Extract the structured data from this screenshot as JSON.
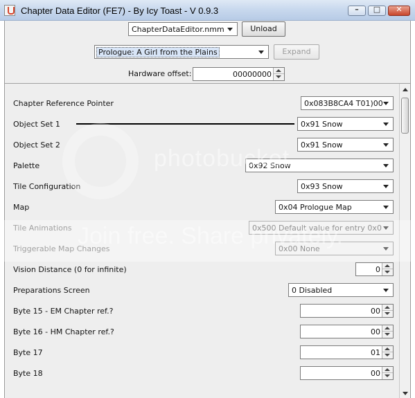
{
  "window": {
    "title": "Chapter Data Editor (FE7) - By Icy Toast - V 0.9.3"
  },
  "top": {
    "module_select": "ChapterDataEditor.nmm",
    "unload_label": "Unload",
    "chapter_select": "Prologue: A Girl from the Plains",
    "expand_label": "Expand",
    "hardware_offset_label": "Hardware offset:",
    "hardware_offset_value": "00000000"
  },
  "fields": [
    {
      "label": "Chapter Reference Pointer",
      "value": "0x083B8CA4 T01)00"
    },
    {
      "label": "Object Set 1",
      "value": "0x91 Snow"
    },
    {
      "label": "Object Set 2",
      "value": "0x91 Snow"
    },
    {
      "label": "Palette",
      "value": "0x92 Snow"
    },
    {
      "label": "Tile Configuration",
      "value": "0x93 Snow"
    },
    {
      "label": "Map",
      "value": "0x04 Prologue Map"
    },
    {
      "label": "Tile Animations",
      "value": "0x500 Default value for entry 0x0"
    },
    {
      "label": "Triggerable Map Changes",
      "value": "0x00 None"
    },
    {
      "label": "Vision Distance (0 for infinite)",
      "value": "0"
    },
    {
      "label": "Preparations Screen",
      "value": "0 Disabled"
    },
    {
      "label": "Byte 15 - EM Chapter ref.?",
      "value": "00"
    },
    {
      "label": "Byte 16 - HM Chapter ref.?",
      "value": "00"
    },
    {
      "label": "Byte 17",
      "value": "01"
    },
    {
      "label": "Byte 18",
      "value": "00"
    }
  ],
  "watermark": {
    "line1": "photobucket",
    "line2": "Join free. Share privately."
  }
}
